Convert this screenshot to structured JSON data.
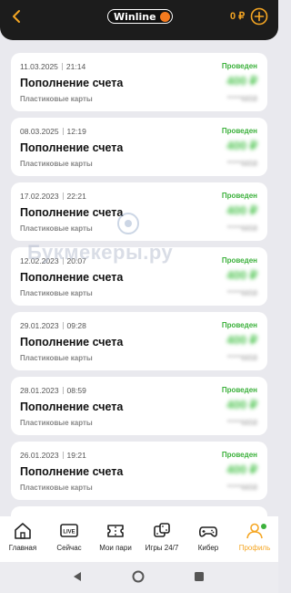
{
  "header": {
    "logo_text": "Winline",
    "balance": "0 ₽"
  },
  "transactions": [
    {
      "date": "11.03.2025",
      "time": "21:14",
      "status": "Проведен",
      "title": "Пополнение счета",
      "amount": "400 ₽",
      "method": "Пластиковые карты",
      "account": "*****6658"
    },
    {
      "date": "08.03.2025",
      "time": "12:19",
      "status": "Проведен",
      "title": "Пополнение счета",
      "amount": "400 ₽",
      "method": "Пластиковые карты",
      "account": "*****6658"
    },
    {
      "date": "17.02.2023",
      "time": "22:21",
      "status": "Проведен",
      "title": "Пополнение счета",
      "amount": "400 ₽",
      "method": "Пластиковые карты",
      "account": "*****6658"
    },
    {
      "date": "12.02.2023",
      "time": "20:07",
      "status": "Проведен",
      "title": "Пополнение счета",
      "amount": "400 ₽",
      "method": "Пластиковые карты",
      "account": "*****6658"
    },
    {
      "date": "29.01.2023",
      "time": "09:28",
      "status": "Проведен",
      "title": "Пополнение счета",
      "amount": "400 ₽",
      "method": "Пластиковые карты",
      "account": "*****6658"
    },
    {
      "date": "28.01.2023",
      "time": "08:59",
      "status": "Проведен",
      "title": "Пополнение счета",
      "amount": "400 ₽",
      "method": "Пластиковые карты",
      "account": "*****6658"
    },
    {
      "date": "26.01.2023",
      "time": "19:21",
      "status": "Проведен",
      "title": "Пополнение счета",
      "amount": "400 ₽",
      "method": "Пластиковые карты",
      "account": "*****6658"
    }
  ],
  "watermark": "Букмекеры.ру",
  "tabs": [
    {
      "label": "Главная",
      "icon": "home-icon"
    },
    {
      "label": "Сейчас",
      "icon": "live-icon"
    },
    {
      "label": "Мои пари",
      "icon": "ticket-icon"
    },
    {
      "label": "Игры 24/7",
      "icon": "dice-icon"
    },
    {
      "label": "Кибер",
      "icon": "gamepad-icon"
    },
    {
      "label": "Профиль",
      "icon": "user-icon"
    }
  ],
  "colors": {
    "accent": "#f5a623",
    "success": "#3cb13c",
    "header_bg": "#1c1c1c",
    "page_bg": "#e9e9ee"
  }
}
